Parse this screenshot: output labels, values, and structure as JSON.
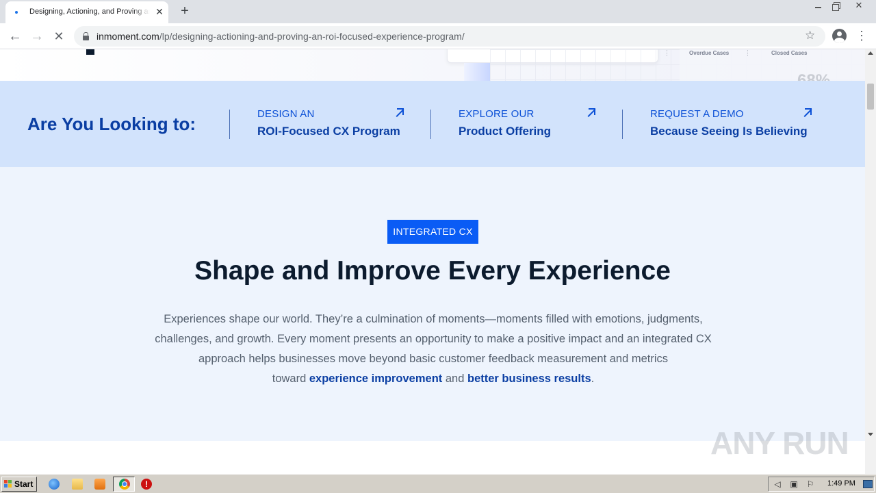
{
  "browser": {
    "tab_title": "Designing, Actioning, and Proving an ROI-Focused Experience Program",
    "tab_close": "✕",
    "new_tab": "+",
    "url_domain": "inmoment.com",
    "url_path": "/lp/designing-actioning-and-proving-an-roi-focused-experience-program/",
    "back_glyph": "←",
    "forward_glyph": "→",
    "stop_glyph": "✕",
    "star_glyph": "☆",
    "menu_glyph": "⋮",
    "window_close": "✕"
  },
  "hero": {
    "overdue_label": "Overdue Cases",
    "closed_label": "Closed Cases",
    "percent_partial": "68%"
  },
  "cta_band": {
    "heading": "Are You Looking to:",
    "links": [
      {
        "eyebrow": "DESIGN AN",
        "title": "ROI-Focused CX Program"
      },
      {
        "eyebrow": "EXPLORE OUR",
        "title": "Product Offering"
      },
      {
        "eyebrow": "REQUEST A DEMO",
        "title": "Because Seeing Is Believing"
      }
    ]
  },
  "integrated": {
    "badge": "INTEGRATED CX",
    "title": "Shape and Improve Every Experience",
    "body_line1": "Experiences shape our world. They’re a culmination of moments—moments filled with emotions, judgments,",
    "body_line2": "challenges, and growth. Every moment presents an opportunity to make a positive impact and an integrated CX",
    "body_line3": "approach helps businesses move beyond basic customer feedback measurement and metrics",
    "body_toward": "toward ",
    "body_link1": "experience improvement",
    "body_and": " and ",
    "body_link2": "better business results",
    "body_period": "."
  },
  "watermark": "ANY RUN",
  "taskbar": {
    "start_label": "Start",
    "clock": "1:49 PM"
  },
  "colors": {
    "brand_blue": "#0a5cf5",
    "dark_blue": "#0a3ea3",
    "band_bg": "#d2e3fc",
    "section_bg": "#eef4fd",
    "title_dark": "#0c1b2e"
  }
}
